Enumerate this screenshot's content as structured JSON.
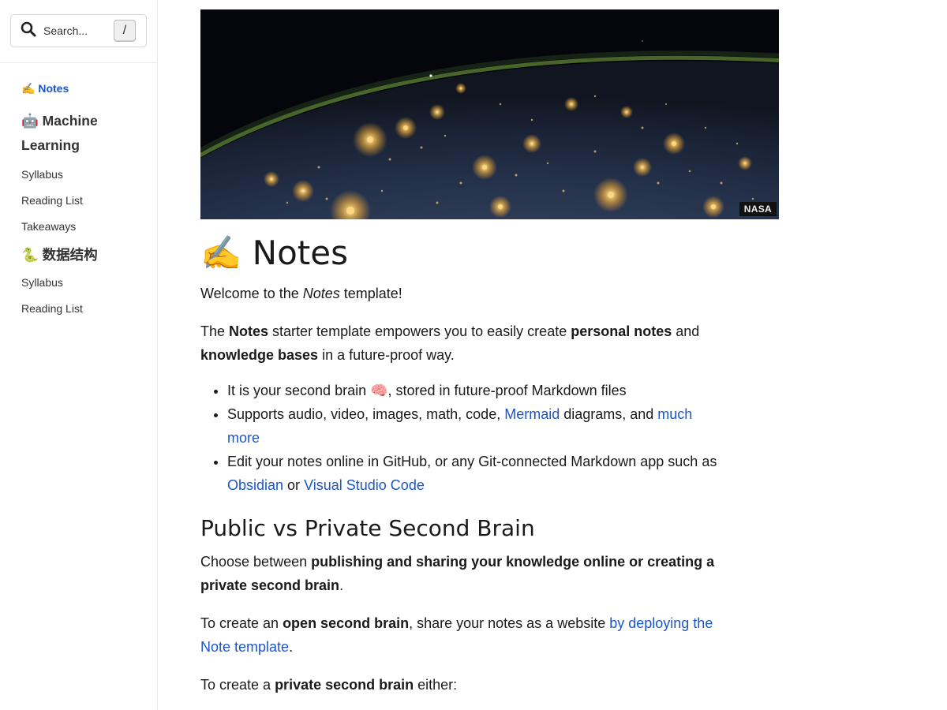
{
  "sidebar": {
    "search": {
      "placeholder": "Search...",
      "shortcut": "/"
    },
    "active": {
      "emoji": "✍️",
      "label": "Notes"
    },
    "groups": [
      {
        "emoji": "🤖",
        "title_line1": "Machine",
        "title_line2": "Learning",
        "items": [
          "Syllabus",
          "Reading List",
          "Takeaways"
        ]
      },
      {
        "emoji": "🐍",
        "title": "数据结构",
        "items": [
          "Syllabus",
          "Reading List"
        ]
      }
    ]
  },
  "hero": {
    "credit": "NASA"
  },
  "article": {
    "title_emoji": "✍️",
    "title": "Notes",
    "welcome": {
      "before": "Welcome to the ",
      "em": "Notes",
      "after": " template!"
    },
    "intro": {
      "t1": "The ",
      "b1": "Notes",
      "t2": " starter template empowers you to easily create ",
      "b2": "personal notes",
      "t3": " and ",
      "b3": "knowledge bases",
      "t4": " in a future-proof way."
    },
    "bullets": {
      "b1_before": "It is your second brain ",
      "b1_emoji": "🧠",
      "b1_after": ", stored in future-proof Markdown files",
      "b2_before": "Supports audio, video, images, math, code, ",
      "b2_link1": "Mermaid",
      "b2_mid": " diagrams, and ",
      "b2_link2": "much more",
      "b3_before": "Edit your notes online in GitHub, or any Git-connected Markdown app such as ",
      "b3_link1": "Obsidian",
      "b3_mid": " or ",
      "b3_link2": "Visual Studio Code"
    },
    "section_title": "Public vs Private Second Brain",
    "choose": {
      "t1": "Choose between ",
      "b1": "publishing and sharing your knowledge online or creating a private second brain",
      "t2": "."
    },
    "open": {
      "t1": "To create an ",
      "b1": "open second brain",
      "t2": ", share your notes as a website ",
      "link": "by deploying the Note template",
      "t3": "."
    },
    "private": {
      "t1": "To create a ",
      "b1": "private second brain",
      "t2": " either:"
    }
  },
  "colors": {
    "link": "#1a56c9",
    "text": "#1a1a1a",
    "sidebar_text": "#333333"
  }
}
